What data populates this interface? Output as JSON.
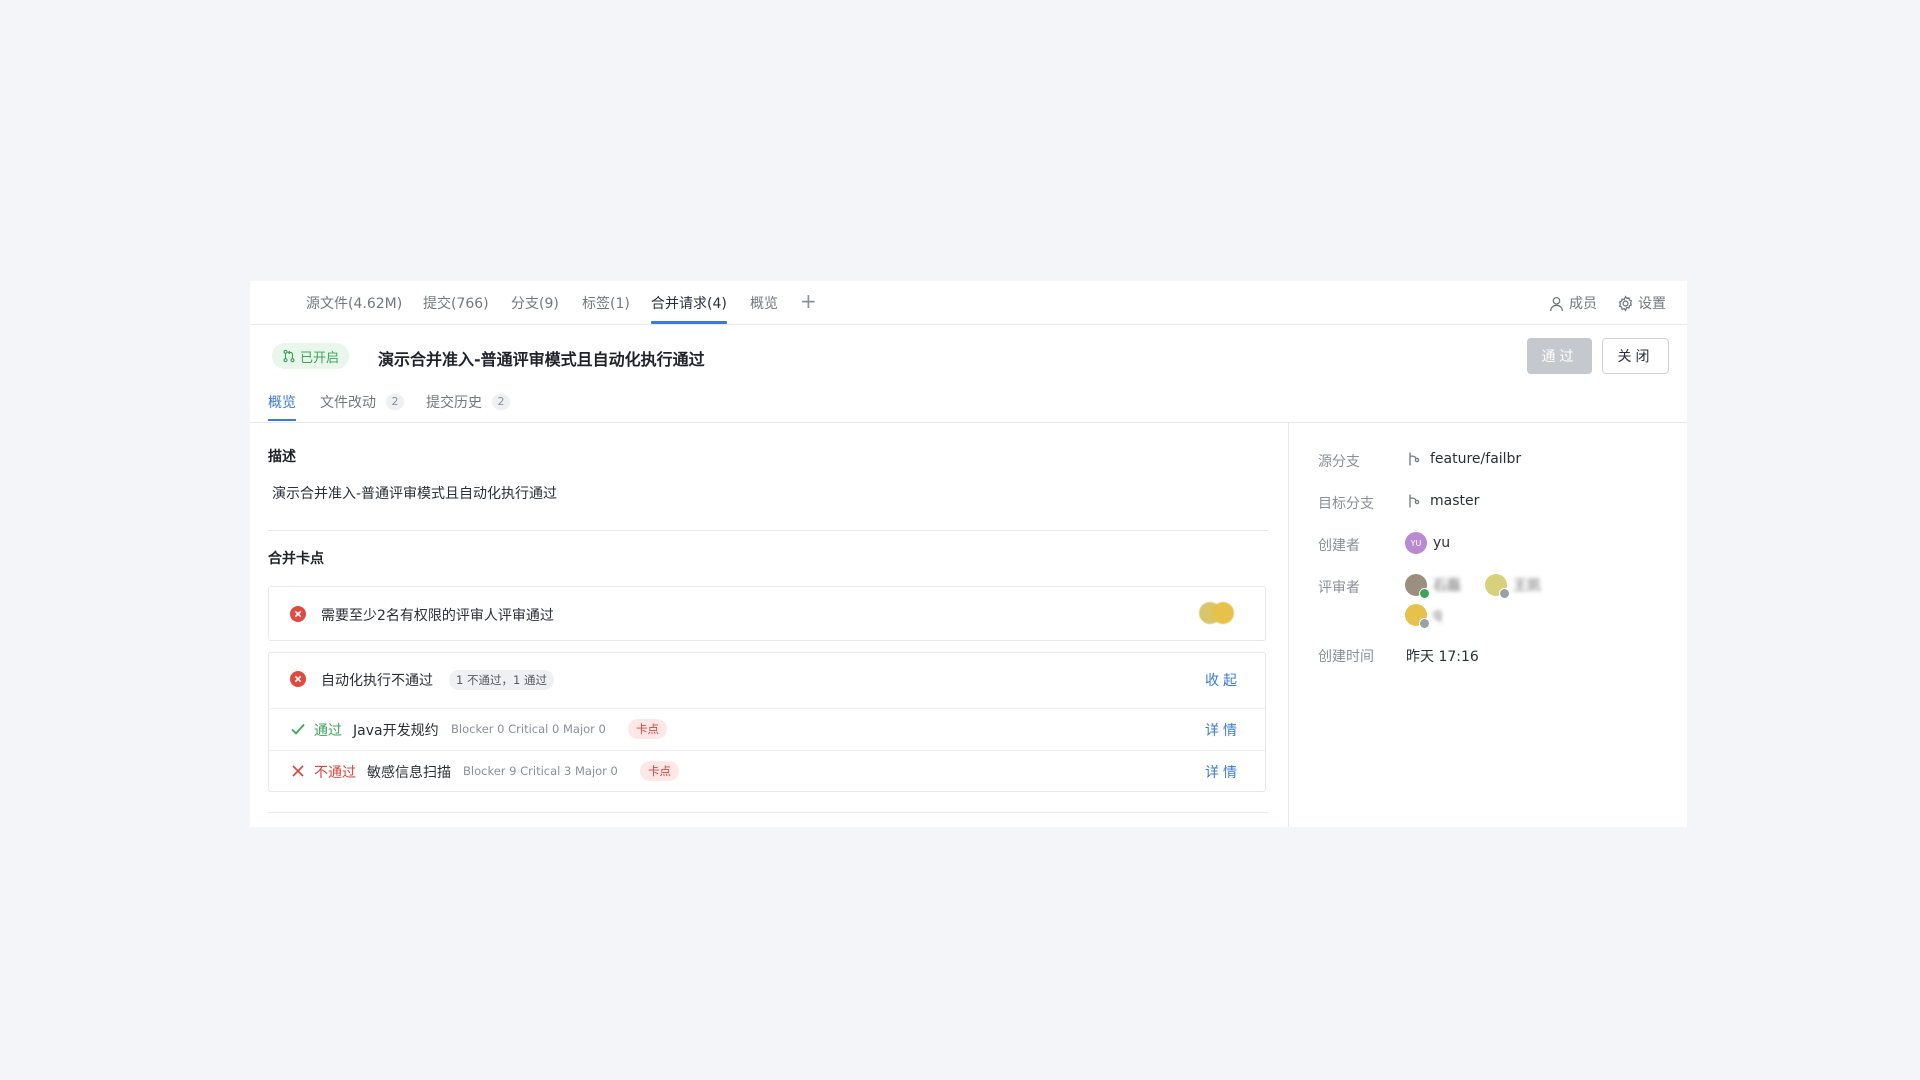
{
  "repo_nav": {
    "tabs": [
      {
        "label": "源文件(4.62M)"
      },
      {
        "label": "提交(766)"
      },
      {
        "label": "分支(9)"
      },
      {
        "label": "标签(1)"
      },
      {
        "label": "合并请求(4)",
        "active": true
      },
      {
        "label": "概览"
      }
    ],
    "add_label": "+",
    "members_label": "成员",
    "settings_label": "设置"
  },
  "mr": {
    "status": "已开启",
    "title": "演示合并准入-普通评审模式且自动化执行通过",
    "approve_label": "通过",
    "close_label": "关闭"
  },
  "sub_tabs": [
    {
      "label": "概览",
      "active": true
    },
    {
      "label": "文件改动",
      "count": "2"
    },
    {
      "label": "提交历史",
      "count": "2"
    }
  ],
  "description": {
    "heading": "描述",
    "text": "演示合并准入-普通评审模式且自动化执行通过"
  },
  "checkpoints": {
    "heading": "合并卡点",
    "review_rule": "需要至少2名有权限的评审人评审通过",
    "automation": {
      "title": "自动化执行不通过",
      "summary": "1 不通过，1 通过",
      "toggle_label": "收起",
      "items": [
        {
          "status": "通过",
          "name": "Java开发规约",
          "metrics": "Blocker 0 Critical 0 Major 0",
          "tag": "卡点",
          "action": "详情"
        },
        {
          "status": "不通过",
          "name": "敏感信息扫描",
          "metrics": "Blocker 9 Critical 3 Major 0",
          "tag": "卡点",
          "action": "详情"
        }
      ]
    }
  },
  "sidebar": {
    "source_branch_label": "源分支",
    "source_branch": "feature/failbr",
    "target_branch_label": "目标分支",
    "target_branch": "master",
    "creator_label": "创建者",
    "creator_name": "yu",
    "creator_initials": "YU",
    "reviewers_label": "评审者",
    "reviewers": [
      {
        "name": "石磊"
      },
      {
        "name": "王凯"
      },
      {
        "name": "q"
      }
    ],
    "created_label": "创建时间",
    "created_value": "昨天 17:16"
  },
  "colors": {
    "accent": "#3a7bd5",
    "success": "#3fa35a",
    "danger": "#d9453b"
  }
}
